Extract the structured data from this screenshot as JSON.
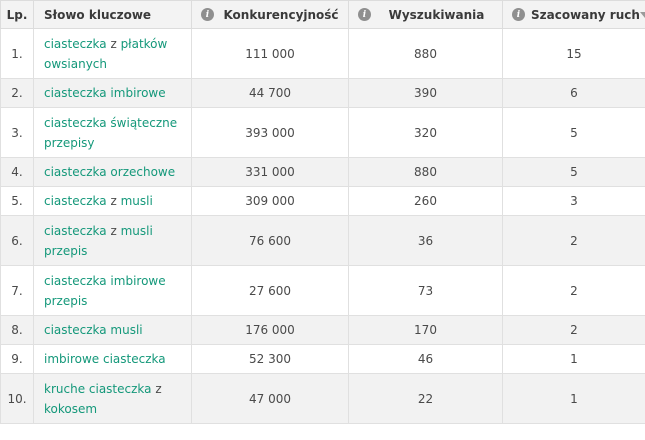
{
  "columns": {
    "lp": "Lp.",
    "keyword": "Słowo kluczowe",
    "competition": "Konkurencyjność",
    "searches": "Wyszukiwania",
    "traffic": "Szacowany ruch"
  },
  "icons": {
    "info": "info-icon",
    "sort": "sort-desc-icon"
  },
  "colors": {
    "keyword_link": "#14987a",
    "header_bg": "#f3f3f3",
    "row_alt_bg": "#f2f2f2"
  },
  "rows": [
    {
      "lp": "1.",
      "keyword_parts": [
        {
          "text": "ciasteczka",
          "style": "link"
        },
        {
          "text": " z ",
          "style": "stop"
        },
        {
          "text": "płatków owsianych",
          "style": "link"
        }
      ],
      "competition": "111 000",
      "searches": "880",
      "traffic": "15"
    },
    {
      "lp": "2.",
      "keyword_parts": [
        {
          "text": "ciasteczka imbirowe",
          "style": "link"
        }
      ],
      "competition": "44 700",
      "searches": "390",
      "traffic": "6"
    },
    {
      "lp": "3.",
      "keyword_parts": [
        {
          "text": "ciasteczka świąteczne przepisy",
          "style": "link"
        }
      ],
      "competition": "393 000",
      "searches": "320",
      "traffic": "5"
    },
    {
      "lp": "4.",
      "keyword_parts": [
        {
          "text": "ciasteczka orzechowe",
          "style": "link"
        }
      ],
      "competition": "331 000",
      "searches": "880",
      "traffic": "5"
    },
    {
      "lp": "5.",
      "keyword_parts": [
        {
          "text": "ciasteczka",
          "style": "link"
        },
        {
          "text": " z ",
          "style": "stop"
        },
        {
          "text": "musli",
          "style": "link"
        }
      ],
      "competition": "309 000",
      "searches": "260",
      "traffic": "3"
    },
    {
      "lp": "6.",
      "keyword_parts": [
        {
          "text": "ciasteczka",
          "style": "link"
        },
        {
          "text": " z ",
          "style": "stop"
        },
        {
          "text": "musli przepis",
          "style": "link"
        }
      ],
      "competition": "76 600",
      "searches": "36",
      "traffic": "2"
    },
    {
      "lp": "7.",
      "keyword_parts": [
        {
          "text": "ciasteczka imbirowe przepis",
          "style": "link"
        }
      ],
      "competition": "27 600",
      "searches": "73",
      "traffic": "2"
    },
    {
      "lp": "8.",
      "keyword_parts": [
        {
          "text": "ciasteczka musli",
          "style": "link"
        }
      ],
      "competition": "176 000",
      "searches": "170",
      "traffic": "2"
    },
    {
      "lp": "9.",
      "keyword_parts": [
        {
          "text": "imbirowe ciasteczka",
          "style": "link"
        }
      ],
      "competition": "52 300",
      "searches": "46",
      "traffic": "1"
    },
    {
      "lp": "10.",
      "keyword_parts": [
        {
          "text": "kruche ciasteczka",
          "style": "link"
        },
        {
          "text": " z ",
          "style": "stop"
        },
        {
          "text": "kokosem",
          "style": "link"
        }
      ],
      "competition": "47 000",
      "searches": "22",
      "traffic": "1"
    }
  ]
}
